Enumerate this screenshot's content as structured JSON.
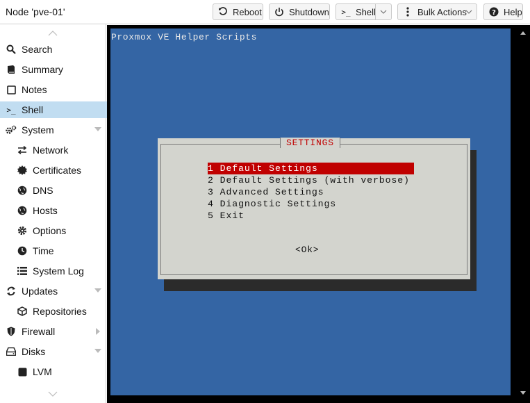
{
  "header": {
    "title": "Node 'pve-01'",
    "buttons": {
      "reboot": "Reboot",
      "shutdown": "Shutdown",
      "shell": "Shell",
      "bulk_actions": "Bulk Actions",
      "help": "Help"
    }
  },
  "sidebar": {
    "items": [
      {
        "label": "Search",
        "icon": "search-icon"
      },
      {
        "label": "Summary",
        "icon": "book-icon"
      },
      {
        "label": "Notes",
        "icon": "note-icon"
      },
      {
        "label": "Shell",
        "icon": "terminal-icon",
        "active": true
      },
      {
        "label": "System",
        "icon": "gears-icon",
        "expandable": true
      },
      {
        "label": "Network",
        "icon": "exchange-icon"
      },
      {
        "label": "Certificates",
        "icon": "certificate-icon"
      },
      {
        "label": "DNS",
        "icon": "globe-icon"
      },
      {
        "label": "Hosts",
        "icon": "globe-icon"
      },
      {
        "label": "Options",
        "icon": "gear-icon"
      },
      {
        "label": "Time",
        "icon": "clock-icon"
      },
      {
        "label": "System Log",
        "icon": "list-icon"
      },
      {
        "label": "Updates",
        "icon": "refresh-icon",
        "expandable": true
      },
      {
        "label": "Repositories",
        "icon": "package-icon"
      },
      {
        "label": "Firewall",
        "icon": "shield-icon",
        "expandable": true
      },
      {
        "label": "Disks",
        "icon": "hdd-icon",
        "expandable": true
      },
      {
        "label": "LVM",
        "icon": "square-icon"
      }
    ]
  },
  "terminal": {
    "title": "Proxmox VE Helper Scripts",
    "dialog": {
      "title": "SETTINGS",
      "items": [
        "1 Default Settings",
        "2 Default Settings (with verbose)",
        "3 Advanced Settings",
        "4 Diagnostic Settings",
        "5 Exit"
      ],
      "selected_index": 0,
      "ok_label": "<Ok>"
    }
  },
  "colors": {
    "terminal_bg": "#3465a4",
    "dialog_bg": "#d3d4ce",
    "highlight": "#c00000",
    "sidebar_active": "#c1ddf1"
  }
}
